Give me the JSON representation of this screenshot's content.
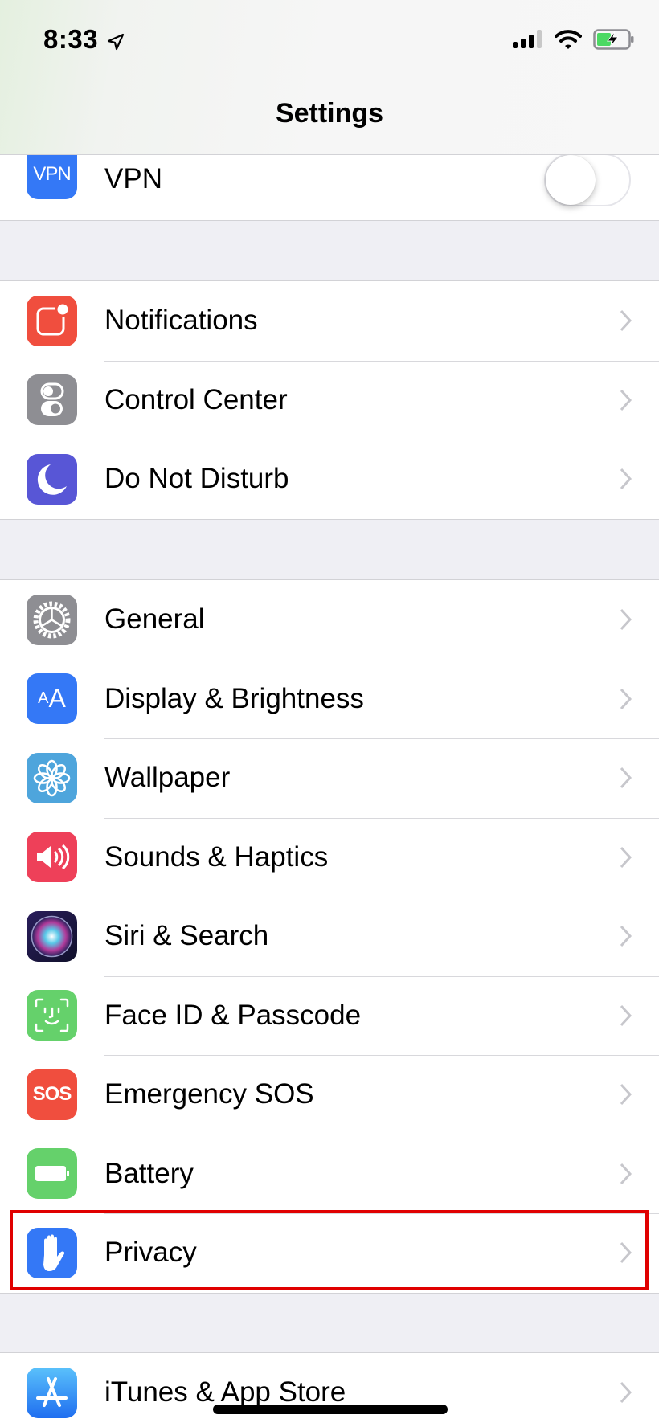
{
  "status_bar": {
    "time": "8:33",
    "location_icon": "location-arrow-icon",
    "signal_icon": "cellular-signal-icon",
    "signal_bars": "3 of 4",
    "wifi_icon": "wifi-icon",
    "battery_icon": "battery-charging-icon",
    "battery_level": 0.45,
    "battery_color": "#4cd964"
  },
  "nav": {
    "title": "Settings"
  },
  "groups": [
    {
      "items": [
        {
          "label": "VPN",
          "icon": "vpn-icon",
          "icon_text": "VPN",
          "icon_color": "#3478f6",
          "control": "toggle",
          "toggle_on": false
        }
      ]
    },
    {
      "items": [
        {
          "label": "Notifications",
          "icon": "notifications-icon",
          "icon_color": "#f04e3e"
        },
        {
          "label": "Control Center",
          "icon": "control-center-icon",
          "icon_color": "#8e8e93"
        },
        {
          "label": "Do Not Disturb",
          "icon": "moon-icon",
          "icon_color": "#5856d6"
        }
      ]
    },
    {
      "items": [
        {
          "label": "General",
          "icon": "gear-icon",
          "icon_color": "#8e8e93"
        },
        {
          "label": "Display & Brightness",
          "icon": "display-brightness-icon",
          "icon_text": "AA",
          "icon_color": "#3478f6"
        },
        {
          "label": "Wallpaper",
          "icon": "wallpaper-flower-icon",
          "icon_color": "#4ea5dc"
        },
        {
          "label": "Sounds & Haptics",
          "icon": "speaker-icon",
          "icon_color": "#ee4059"
        },
        {
          "label": "Siri & Search",
          "icon": "siri-icon",
          "icon_color": "#1c1c3c"
        },
        {
          "label": "Face ID & Passcode",
          "icon": "face-id-icon",
          "icon_color": "#65d16b"
        },
        {
          "label": "Emergency SOS",
          "icon": "sos-icon",
          "icon_text": "SOS",
          "icon_color": "#f04e3e"
        },
        {
          "label": "Battery",
          "icon": "battery-icon",
          "icon_color": "#65d16b"
        },
        {
          "label": "Privacy",
          "icon": "hand-icon",
          "icon_color": "#3478f6",
          "highlighted": true
        }
      ]
    },
    {
      "items": [
        {
          "label": "iTunes & App Store",
          "icon": "app-store-icon",
          "icon_color": "#2f8ef5"
        }
      ]
    }
  ],
  "highlight_color": "#e00000"
}
